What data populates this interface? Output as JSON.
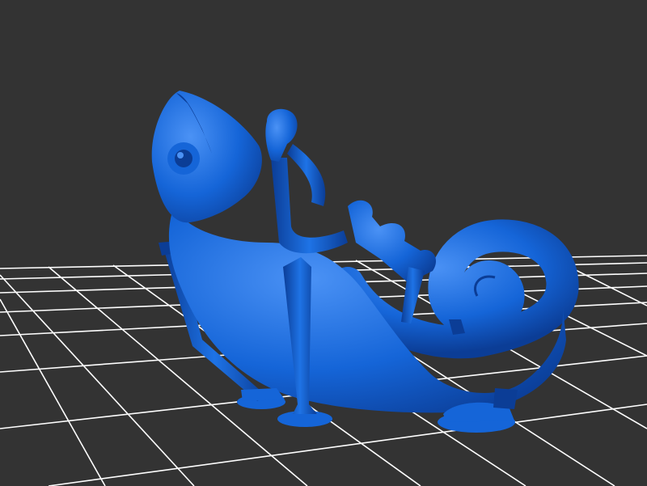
{
  "scene": {
    "background_color": "#333333",
    "grid_color": "#ffffff",
    "model_color": "#1565d8",
    "model_highlight": "#4b92f5",
    "model_shadow": "#0b3d96",
    "subject": "chameleon-on-support-struts"
  }
}
